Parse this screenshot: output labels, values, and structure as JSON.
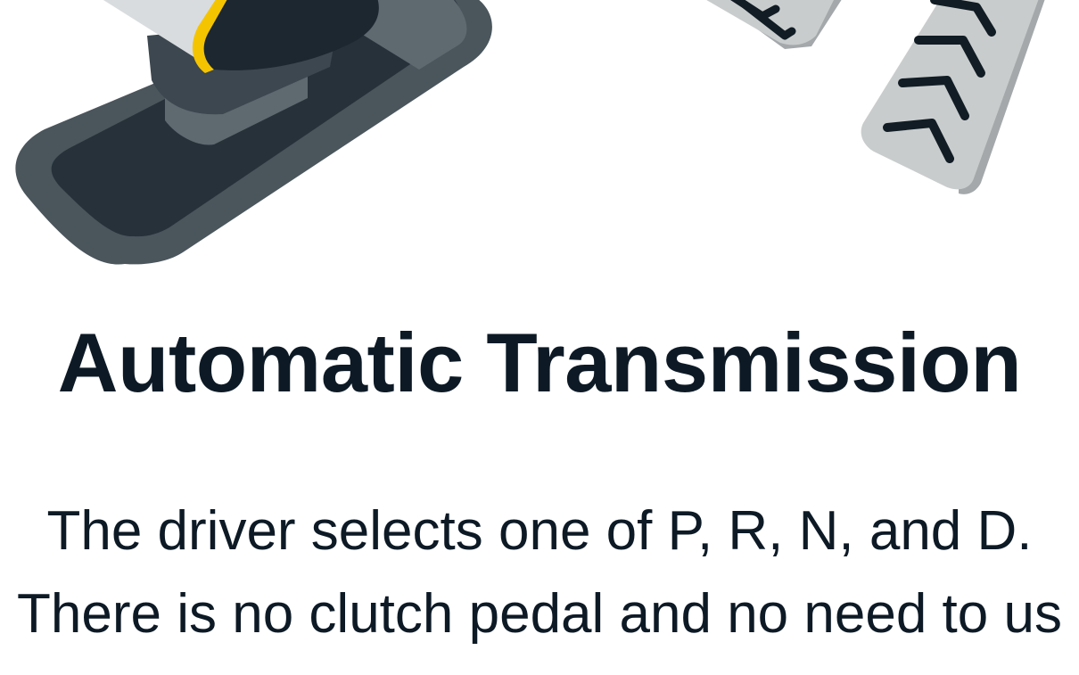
{
  "heading": {
    "title": "Automatic Transmission"
  },
  "description": {
    "line1": "The driver selects one of P, R, N, and D.",
    "line2": "There is no clutch pedal and no need to us"
  },
  "illustration": {
    "gear_shifter_icon": "gear-shifter-icon",
    "pedal_icon": "pedal-icon",
    "colors": {
      "base_dark": "#263139",
      "base_rim": "#4a555c",
      "boot_mid": "#3c474f",
      "boot_light": "#5e6970",
      "knob_dark": "#1c2730",
      "knob_silver": "#d9dcde",
      "accent_yellow": "#f5c400",
      "pedal_face": "#c9cccd",
      "pedal_side": "#a4a8aa",
      "pedal_grip": "#111c24"
    }
  }
}
